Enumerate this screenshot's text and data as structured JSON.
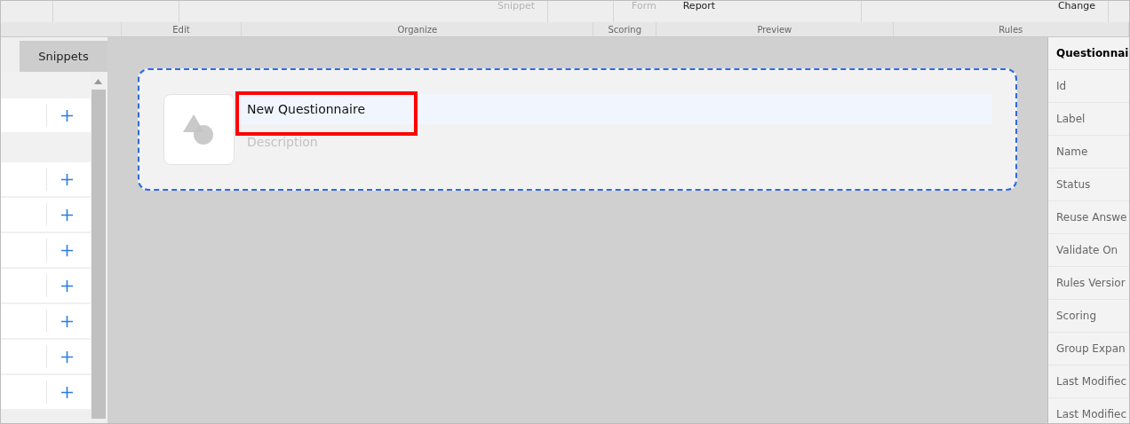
{
  "ribbon": {
    "groups": [
      {
        "label": "Edit"
      },
      {
        "label": "Organize",
        "items": [
          {
            "label": "Snippet",
            "disabled": true
          }
        ]
      },
      {
        "label": "Scoring"
      },
      {
        "label": "Preview",
        "items": [
          {
            "label": "Form",
            "disabled": true
          },
          {
            "label": "Report",
            "disabled": false
          }
        ]
      },
      {
        "label": "Rules",
        "items": [
          {
            "label": "Change",
            "disabled": false
          }
        ]
      }
    ]
  },
  "snippets_panel": {
    "tab": "Snippets",
    "rows": [
      {
        "kind": "item"
      },
      {
        "kind": "section"
      },
      {
        "kind": "item"
      },
      {
        "kind": "item"
      },
      {
        "kind": "item"
      },
      {
        "kind": "item"
      },
      {
        "kind": "item"
      },
      {
        "kind": "item"
      },
      {
        "kind": "item"
      }
    ]
  },
  "questionnaire_card": {
    "title": "New Questionnaire",
    "description_placeholder": "Description",
    "highlighted": true
  },
  "properties": {
    "header": "Questionnai",
    "items": [
      "Id",
      "Label",
      "Name",
      "Status",
      "Reuse Answe",
      "Validate On",
      "Rules Versior",
      "Scoring",
      "Group Expan",
      "Last Modifiec",
      "Last Modifiec"
    ]
  }
}
